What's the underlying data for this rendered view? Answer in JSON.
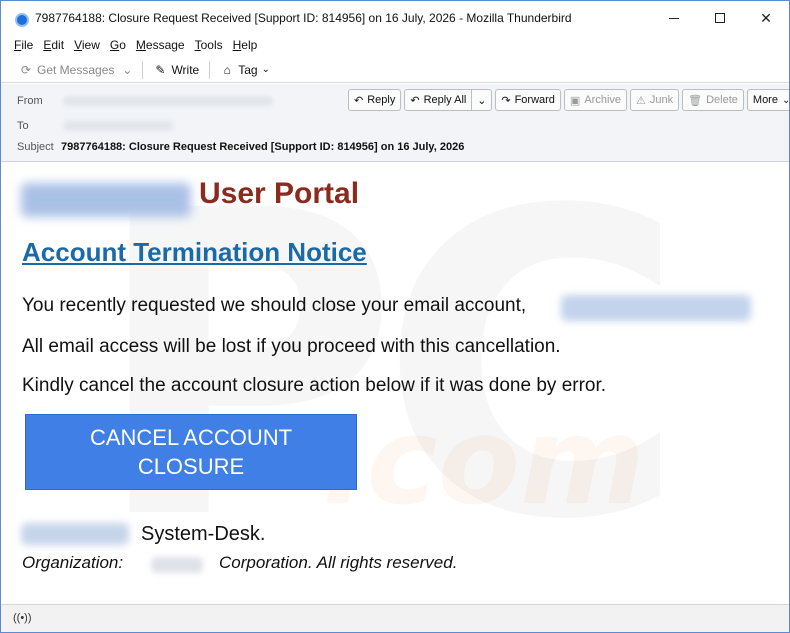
{
  "window": {
    "title": "7987764188: Closure Request Received [Support ID: 814956] on 16 July, 2026 - Mozilla Thunderbird"
  },
  "menu": [
    "File",
    "Edit",
    "View",
    "Go",
    "Message",
    "Tools",
    "Help"
  ],
  "toolbar": {
    "get_messages": "Get Messages",
    "write": "Write",
    "tag": "Tag"
  },
  "header": {
    "from_label": "From",
    "to_label": "To",
    "subject_label": "Subject",
    "subject": "7987764188: Closure Request Received [Support ID: 814956] on 16 July, 2026",
    "buttons": {
      "reply": "Reply",
      "reply_all": "Reply All",
      "forward": "Forward",
      "archive": "Archive",
      "junk": "Junk",
      "delete": "Delete",
      "more": "More"
    }
  },
  "body": {
    "portal_title": "User Portal",
    "notice": "Account Termination Notice",
    "line1": "You recently requested we should close your email account,",
    "line2": "All email access will be lost if you proceed with this cancellation.",
    "line3": "Kindly cancel the account closure action below if it was done by error.",
    "cancel_button": "CANCEL ACCOUNT CLOSURE",
    "signature": "System-Desk.",
    "org_label": "Organization:",
    "org_rest": "Corporation. All rights reserved."
  },
  "icons": {
    "app": "thunderbird-icon",
    "status": "connection-status-icon"
  },
  "colors": {
    "portal_title": "#8b2a1e",
    "notice_link": "#1b6aa8",
    "cancel_button": "#3f7fe6"
  }
}
